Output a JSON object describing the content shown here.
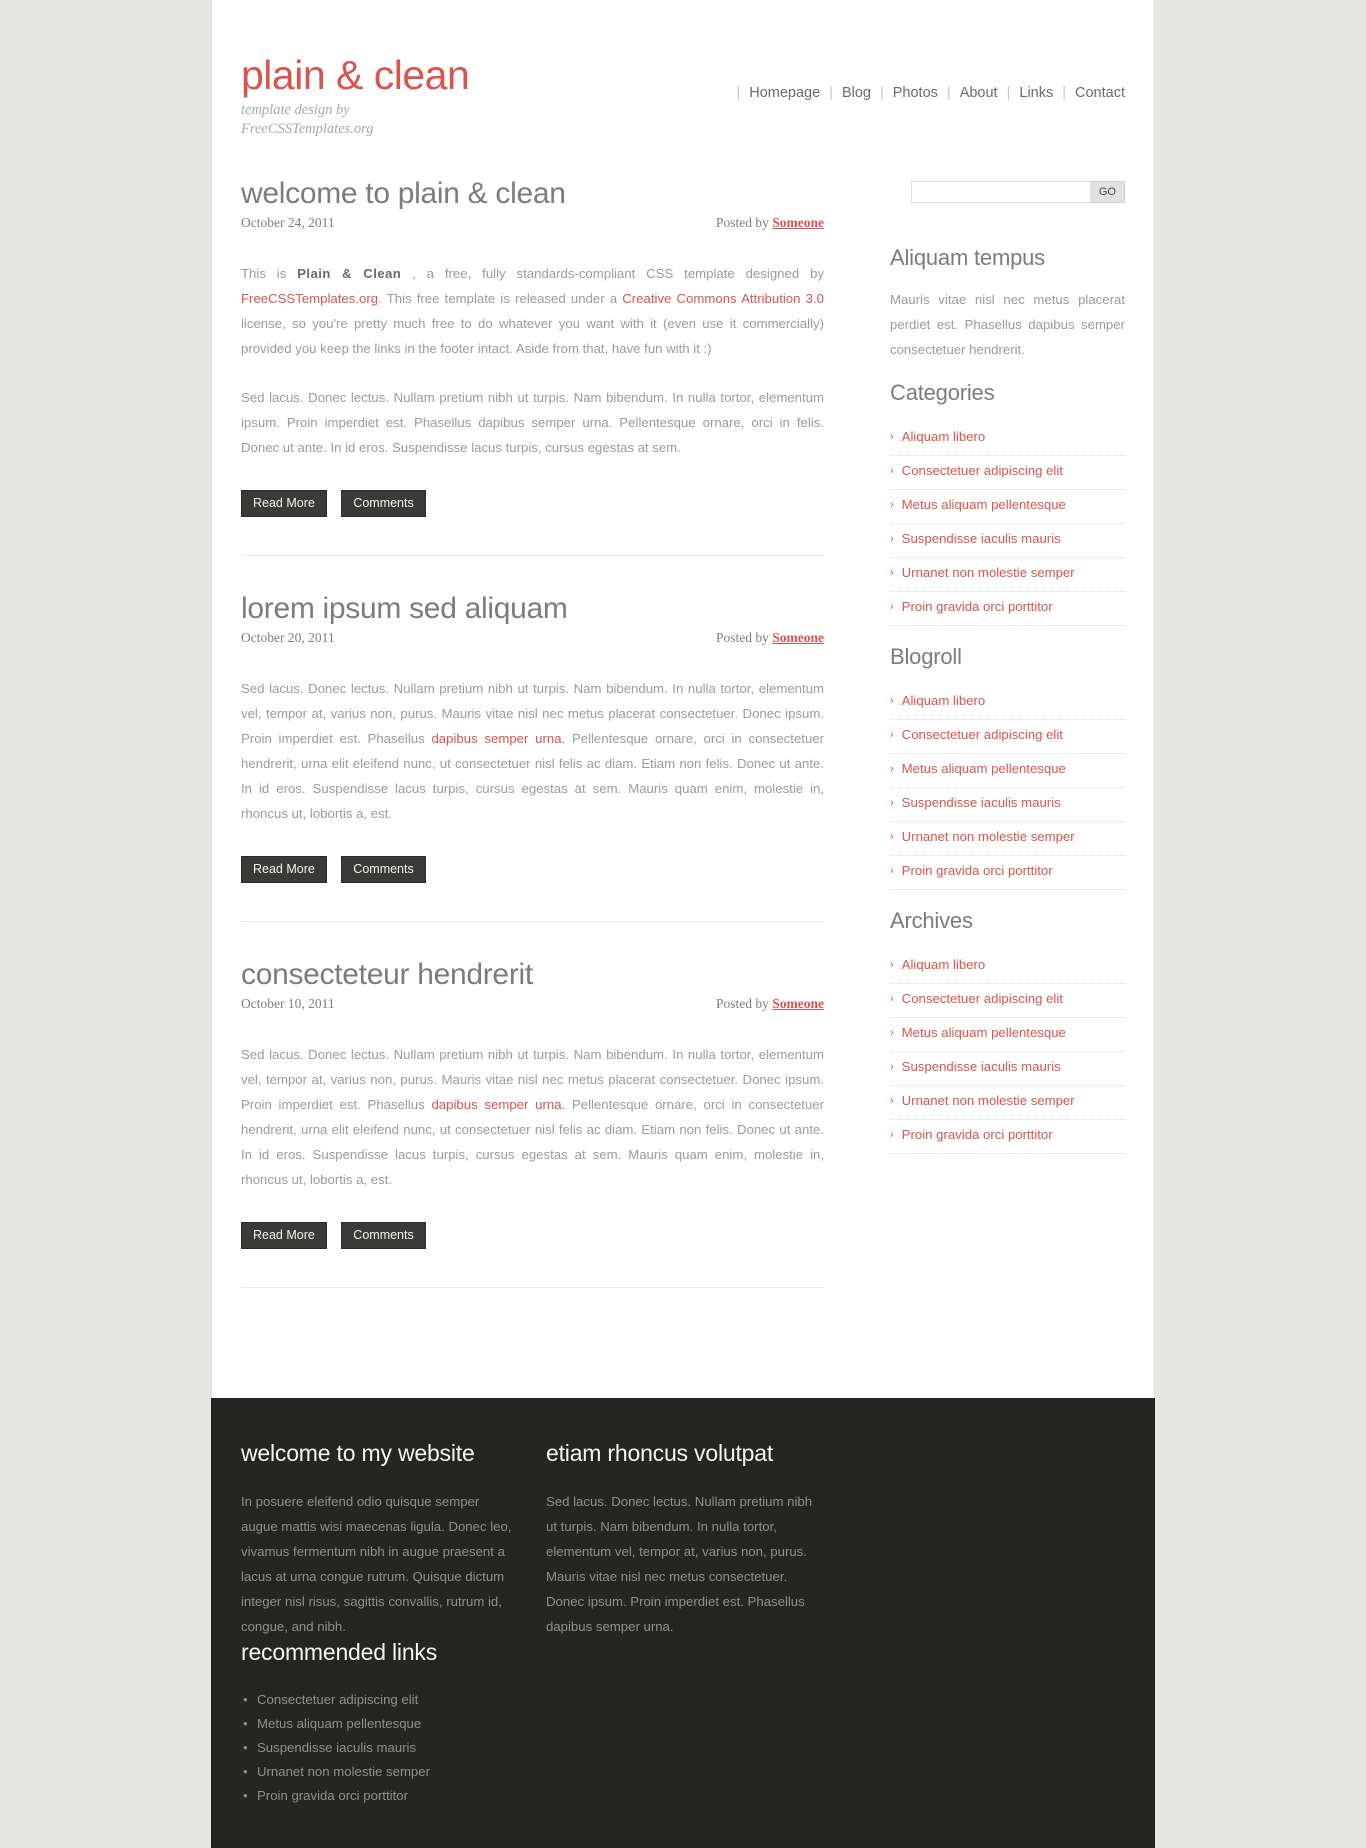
{
  "site": {
    "logo_title": "plain & clean",
    "tagline_line1": "template design by",
    "tagline_line2": "FreeCSSTemplates.org",
    "accent_color": "#d9544e",
    "body_text_color": "#9b9b99",
    "footer_bg": "#252523"
  },
  "nav": {
    "separator": "|",
    "items": [
      {
        "label": "Homepage"
      },
      {
        "label": "Blog"
      },
      {
        "label": "Photos"
      },
      {
        "label": "About"
      },
      {
        "label": "Links"
      },
      {
        "label": "Contact"
      }
    ]
  },
  "search": {
    "value": "",
    "placeholder": "",
    "button_label": "GO"
  },
  "posts": [
    {
      "title": "welcome to plain & clean",
      "date": "October 24, 2011",
      "posted_by_label": "Posted by",
      "author": "Someone",
      "para1_a": "This is ",
      "para1_strong": "Plain & Clean",
      "para1_b": " , a free, fully standards-compliant CSS template designed by ",
      "para1_link1": "FreeCSSTemplates.org",
      "para1_c": ". This free template is released under a ",
      "para1_link2": "Creative Commons Attribution 3.0",
      "para1_d": " license, so you're pretty much free to do whatever you want with it (even use it commercially) provided you keep the links in the footer intact. Aside from that, have fun with it :)",
      "para2": "Sed lacus. Donec lectus. Nullam pretium nibh ut turpis. Nam bibendum. In nulla tortor, elementum ipsum. Proin imperdiet est. Phasellus dapibus semper urna. Pellentesque ornare, orci in felis. Donec ut ante. In id eros. Suspendisse lacus turpis, cursus egestas at sem.",
      "read_more": "Read More",
      "comments": "Comments"
    },
    {
      "title": "lorem ipsum sed aliquam",
      "date": "October 20, 2011",
      "posted_by_label": "Posted by",
      "author": "Someone",
      "para_a": "Sed lacus. Donec lectus. Nullam pretium nibh ut turpis. Nam bibendum. In nulla tortor, elementum vel, tempor at, varius non, purus. Mauris vitae nisl nec metus placerat consectetuer. Donec ipsum. Proin imperdiet est. Phasellus ",
      "para_link": "dapibus semper urna",
      "para_b": ". Pellentesque ornare, orci in consectetuer hendrerit, urna elit eleifend nunc, ut consectetuer nisl felis ac diam. Etiam non felis. Donec ut ante. In id eros. Suspendisse lacus turpis, cursus egestas at sem. Mauris quam enim, molestie in, rhoncus ut, lobortis a, est.",
      "read_more": "Read More",
      "comments": "Comments"
    },
    {
      "title": "consecteteur hendrerit",
      "date": "October 10, 2011",
      "posted_by_label": "Posted by",
      "author": "Someone",
      "para_a": "Sed lacus. Donec lectus. Nullam pretium nibh ut turpis. Nam bibendum. In nulla tortor, elementum vel, tempor at, varius non, purus. Mauris vitae nisl nec metus placerat consectetuer. Donec ipsum. Proin imperdiet est. Phasellus ",
      "para_link": "dapibus semper urna",
      "para_b": ". Pellentesque ornare, orci in consectetuer hendrerit, urna elit eleifend nunc, ut consectetuer nisl felis ac diam. Etiam non felis. Donec ut ante. In id eros. Suspendisse lacus turpis, cursus egestas at sem. Mauris quam enim, molestie in, rhoncus ut, lobortis a, est.",
      "read_more": "Read More",
      "comments": "Comments"
    }
  ],
  "sidebar": {
    "about": {
      "title": "Aliquam tempus",
      "text": "Mauris vitae nisl nec metus placerat perdiet est. Phasellus dapibus semper consectetuer hendrerit."
    },
    "categories": {
      "title": "Categories",
      "bullet": "›",
      "items": [
        {
          "label": "Aliquam libero"
        },
        {
          "label": "Consectetuer adipiscing elit"
        },
        {
          "label": "Metus aliquam pellentesque"
        },
        {
          "label": "Suspendisse iaculis mauris"
        },
        {
          "label": "Urnanet non molestie semper"
        },
        {
          "label": "Proin gravida orci porttitor"
        }
      ]
    },
    "blogroll": {
      "title": "Blogroll",
      "bullet": "›",
      "items": [
        {
          "label": "Aliquam libero"
        },
        {
          "label": "Consectetuer adipiscing elit"
        },
        {
          "label": "Metus aliquam pellentesque"
        },
        {
          "label": "Suspendisse iaculis mauris"
        },
        {
          "label": "Urnanet non molestie semper"
        },
        {
          "label": "Proin gravida orci porttitor"
        }
      ]
    },
    "archives": {
      "title": "Archives",
      "bullet": "›",
      "items": [
        {
          "label": "Aliquam libero"
        },
        {
          "label": "Consectetuer adipiscing elit"
        },
        {
          "label": "Metus aliquam pellentesque"
        },
        {
          "label": "Suspendisse iaculis mauris"
        },
        {
          "label": "Urnanet non molestie semper"
        },
        {
          "label": "Proin gravida orci porttitor"
        }
      ]
    }
  },
  "footer": {
    "col1": {
      "title": "welcome to my website",
      "text": "In posuere eleifend odio quisque semper augue mattis wisi maecenas ligula. Donec leo, vivamus fermentum nibh in augue praesent a lacus at urna congue rutrum. Quisque dictum integer nisl risus, sagittis convallis, rutrum id, congue, and nibh."
    },
    "col2": {
      "title": "etiam rhoncus volutpat",
      "text": "Sed lacus. Donec lectus. Nullam pretium nibh ut turpis. Nam bibendum. In nulla tortor, elementum vel, tempor at, varius non, purus. Mauris vitae nisl nec metus consectetuer. Donec ipsum. Proin imperdiet est. Phasellus dapibus semper urna."
    },
    "col3": {
      "title": "recommended links",
      "items": [
        {
          "label": "Consectetuer adipiscing elit"
        },
        {
          "label": "Metus aliquam pellentesque"
        },
        {
          "label": "Suspendisse iaculis mauris"
        },
        {
          "label": "Urnanet non molestie semper"
        },
        {
          "label": "Proin gravida orci porttitor"
        }
      ]
    }
  }
}
